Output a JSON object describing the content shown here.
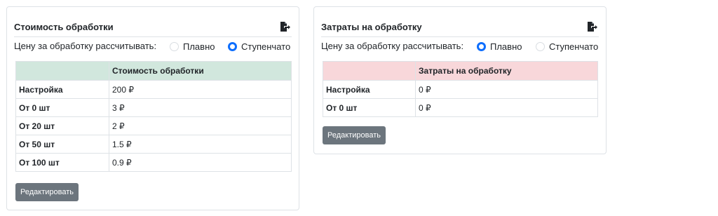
{
  "cards": [
    {
      "title": "Стоимость обработки",
      "price_mode_label": "Цену за обработку рассчитывать:",
      "options": [
        {
          "label": "Плавно",
          "checked": false
        },
        {
          "label": "Ступенчато",
          "checked": true
        }
      ],
      "table_header": [
        "",
        "Стоимость обработки"
      ],
      "header_color": "#d1e7dd",
      "rows": [
        {
          "label": "Настройка",
          "value": "200 ₽"
        },
        {
          "label": "От 0 шт",
          "value": "3 ₽"
        },
        {
          "label": "От 20 шт",
          "value": "2 ₽"
        },
        {
          "label": "От 50 шт",
          "value": "1.5 ₽"
        },
        {
          "label": "От 100 шт",
          "value": "0.9 ₽"
        }
      ],
      "edit_label": "Редактировать"
    },
    {
      "title": "Затраты на обработку",
      "price_mode_label": "Цену за обработку рассчитывать:",
      "options": [
        {
          "label": "Плавно",
          "checked": true
        },
        {
          "label": "Ступенчато",
          "checked": false
        }
      ],
      "table_header": [
        "",
        "Затраты на обработку"
      ],
      "header_color": "#f8d7da",
      "rows": [
        {
          "label": "Настройка",
          "value": "0 ₽"
        },
        {
          "label": "От 0 шт",
          "value": "0 ₽"
        }
      ],
      "edit_label": "Редактировать"
    }
  ],
  "icons": {
    "export": "export-file-icon"
  },
  "colors": {
    "accent": "#0d6efd",
    "button": "#6c757d",
    "border": "#dee2e6"
  }
}
